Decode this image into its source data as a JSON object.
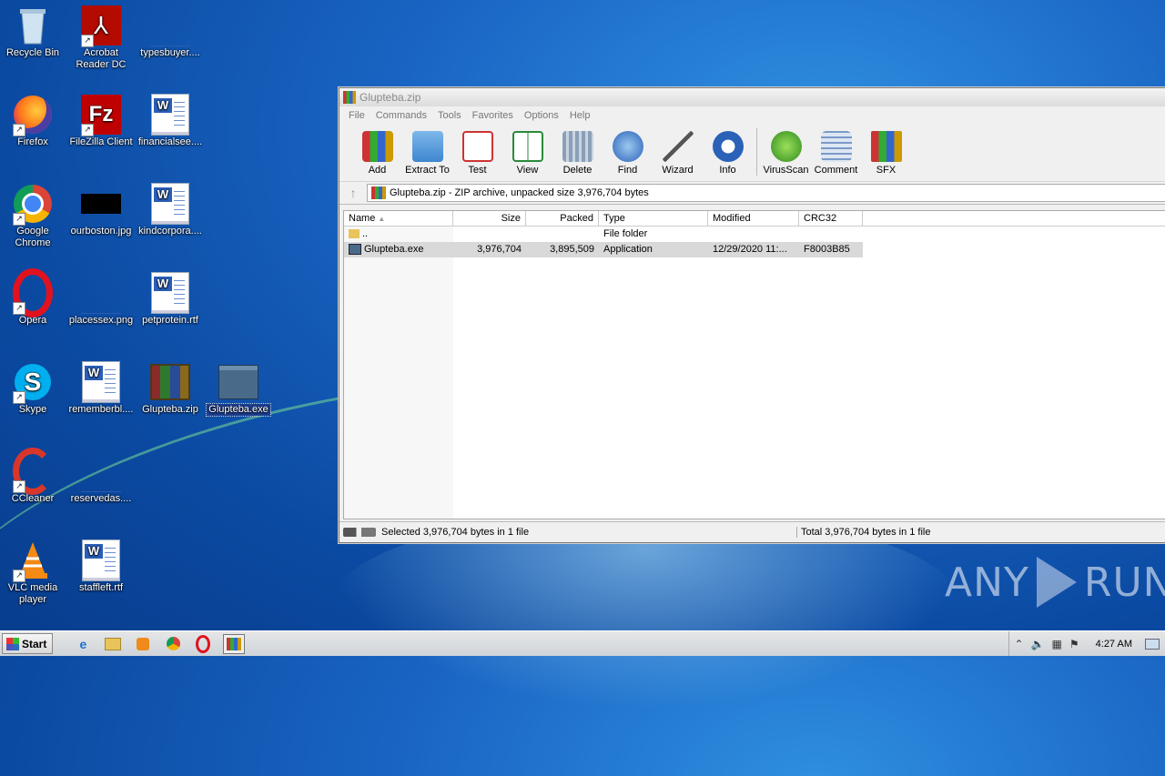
{
  "desktop": {
    "icons": [
      {
        "label": "Recycle Bin"
      },
      {
        "label": "Acrobat Reader DC"
      },
      {
        "label": "typesbuyer...."
      },
      {
        "label": "Firefox"
      },
      {
        "label": "FileZilla Client"
      },
      {
        "label": "financialsee...."
      },
      {
        "label": "Google Chrome"
      },
      {
        "label": "ourboston.jpg"
      },
      {
        "label": "kindcorpora...."
      },
      {
        "label": "Opera"
      },
      {
        "label": "placessex.png"
      },
      {
        "label": "petprotein.rtf"
      },
      {
        "label": "Skype"
      },
      {
        "label": "rememberbl...."
      },
      {
        "label": "Glupteba.zip"
      },
      {
        "label": "Glupteba.exe"
      },
      {
        "label": "CCleaner"
      },
      {
        "label": "reservedas...."
      },
      {
        "label": "VLC media player"
      },
      {
        "label": "staffleft.rtf"
      }
    ]
  },
  "window": {
    "title": "Glupteba.zip",
    "menu": [
      "File",
      "Commands",
      "Tools",
      "Favorites",
      "Options",
      "Help"
    ],
    "toolbar": [
      "Add",
      "Extract To",
      "Test",
      "View",
      "Delete",
      "Find",
      "Wizard",
      "Info",
      "VirusScan",
      "Comment",
      "SFX"
    ],
    "address": "Glupteba.zip - ZIP archive, unpacked size 3,976,704 bytes",
    "columns": [
      "Name",
      "Size",
      "Packed",
      "Type",
      "Modified",
      "CRC32"
    ],
    "rows": [
      {
        "name": "..",
        "size": "",
        "packed": "",
        "type": "File folder",
        "modified": "",
        "crc": ""
      },
      {
        "name": "Glupteba.exe",
        "size": "3,976,704",
        "packed": "3,895,509",
        "type": "Application",
        "modified": "12/29/2020 11:...",
        "crc": "F8003B85"
      }
    ],
    "status_left": "Selected 3,976,704 bytes in 1 file",
    "status_right": "Total 3,976,704 bytes in 1 file"
  },
  "taskbar": {
    "start_label": "Start",
    "clock": "4:27 AM"
  },
  "watermark": {
    "left": "ANY",
    "right": "RUN"
  }
}
